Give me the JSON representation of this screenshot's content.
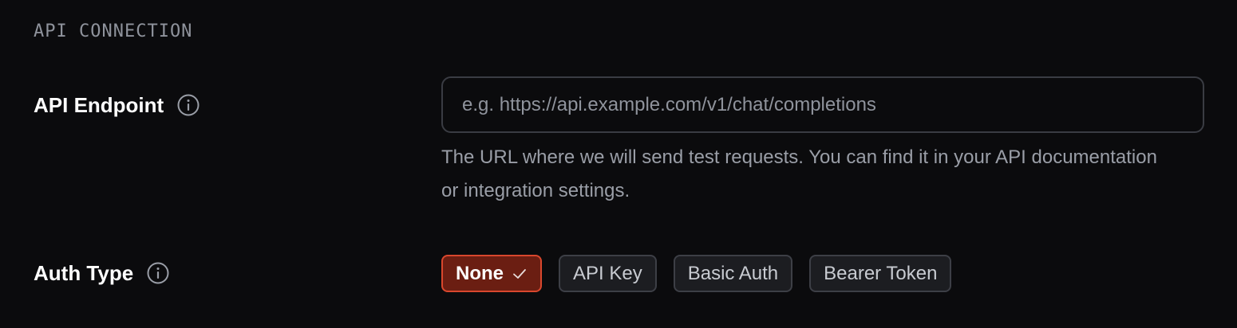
{
  "section": {
    "title": "API CONNECTION"
  },
  "endpoint": {
    "label": "API Endpoint",
    "info_icon": "info-icon",
    "value": "",
    "placeholder": "e.g. https://api.example.com/v1/chat/completions",
    "helper": "The URL where we will send test requests. You can find it in your API documentation or integration settings."
  },
  "auth": {
    "label": "Auth Type",
    "info_icon": "info-icon",
    "selected": "None",
    "options": [
      {
        "label": "None",
        "selected": true,
        "icon": "check-icon"
      },
      {
        "label": "API Key",
        "selected": false
      },
      {
        "label": "Basic Auth",
        "selected": false
      },
      {
        "label": "Bearer Token",
        "selected": false
      }
    ]
  },
  "colors": {
    "background": "#0b0b0d",
    "accent_border": "#d9472d",
    "accent_fill": "#6b1e12",
    "muted_text": "#9a9ea7"
  }
}
